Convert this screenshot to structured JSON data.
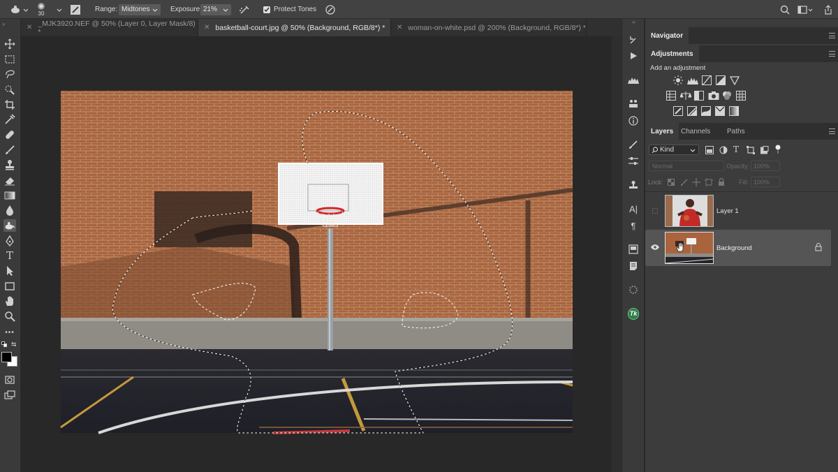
{
  "options_bar": {
    "brush_size": "30",
    "range_label": "Range:",
    "range_value": "Midtones",
    "exposure_label": "Exposure:",
    "exposure_value": "21%",
    "protect_tones": "Protect Tones",
    "protect_tones_checked": true
  },
  "tabs": [
    {
      "label": "_MJK3920.NEF @ 50% (Layer 0, Layer Mask/8) *",
      "active": false
    },
    {
      "label": "basketball-court.jpg @ 50% (Background, RGB/8*) *",
      "active": true
    },
    {
      "label": "woman-on-white.psd @ 200% (Background, RGB/8*) *",
      "active": false
    }
  ],
  "navigator": {
    "title": "Navigator"
  },
  "adjustments": {
    "title": "Adjustments",
    "add_label": "Add an adjustment"
  },
  "layers_panel": {
    "tabs": [
      "Layers",
      "Channels",
      "Paths"
    ],
    "filter_kind": "Kind",
    "blend_mode": "Normal",
    "opacity_label": "Opacity:",
    "opacity_value": "100%",
    "lock_label": "Lock:",
    "fill_label": "Fill:",
    "fill_value": "100%",
    "layers": [
      {
        "name": "Layer 1",
        "visible": false,
        "selected": false,
        "locked": false
      },
      {
        "name": "Background",
        "visible": true,
        "selected": true,
        "locked": true
      }
    ]
  },
  "colors": {
    "foreground": "#000000",
    "background": "#ffffff",
    "accent_green": "#2f7d4a"
  }
}
